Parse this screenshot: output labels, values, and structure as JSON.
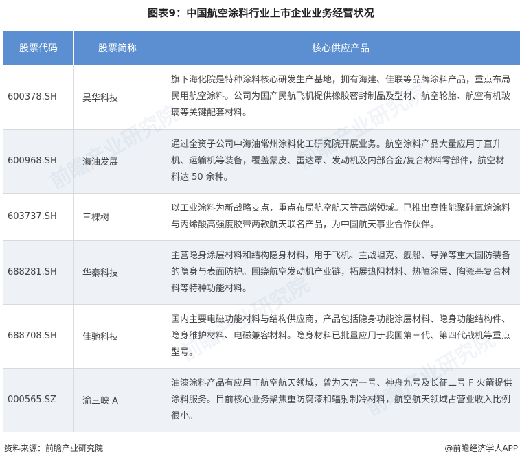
{
  "title": "图表9：中国航空涂料行业上市企业业务经营状况",
  "table": {
    "headers": [
      "股票代码",
      "股票简称",
      "核心供应产品"
    ],
    "rows": [
      {
        "code": "600378.SH",
        "name": "昊华科技",
        "desc": "旗下海化院是特种涂料核心研发生产基地，拥有海建、佳联等品牌涂料产品，重点布局民用航空涂料。公司为国产民航飞机提供橡胶密封制品及型材、航空轮胎、航空有机玻璃等关键配套材料。"
      },
      {
        "code": "600968.SH",
        "name": "海油发展",
        "desc": "通过全资子公司中海油常州涂料化工研究院开展业务。航空涂料产品大量应用于直升机、运输机等装备，覆盖蒙皮、雷达罩、发动机及内部合金/复合材料零部件，航空材料达 50 余种。"
      },
      {
        "code": "603737.SH",
        "name": "三棵树",
        "desc": "以工业涂料为新战略支点，重点布局航空航天等高端领域。已推出高性能聚硅氧烷涂料与丙烯酸高强度胶带两款航天联名产品，为中国航天事业合作伙伴。"
      },
      {
        "code": "688281.SH",
        "name": "华秦科技",
        "desc": "主营隐身涂层材料和结构隐身材料，用于飞机、主战坦克、舰船、导弹等重大国防装备的隐身与表面防护。围绕航空发动机产业链，拓展热阻材料、热障涂层、陶瓷基复合材料等特种功能材料。"
      },
      {
        "code": "688708.SH",
        "name": "佳驰科技",
        "desc": "国内主要电磁功能材料与结构供应商，产品包括隐身功能涂层材料、隐身功能结构件、隐身维护材料、电磁兼容材料。隐身材料已批量应用于我国第三代、第四代战机等重点型号。"
      },
      {
        "code": "000565.SZ",
        "name": "渝三峡 A",
        "desc": "油漆涂料产品有应用于航空航天领域，曾为天宫一号、神舟九号及长征二号 F 火箭提供涂料服务。目前核心业务聚焦重防腐漆和辐射制冷材料，航空航天领域占营业收入比例很小。"
      }
    ]
  },
  "footer": {
    "source": "资料来源：前瞻产业研究院",
    "brand": "@前瞻经济学人APP"
  },
  "watermark": "前瞻产业研究院"
}
